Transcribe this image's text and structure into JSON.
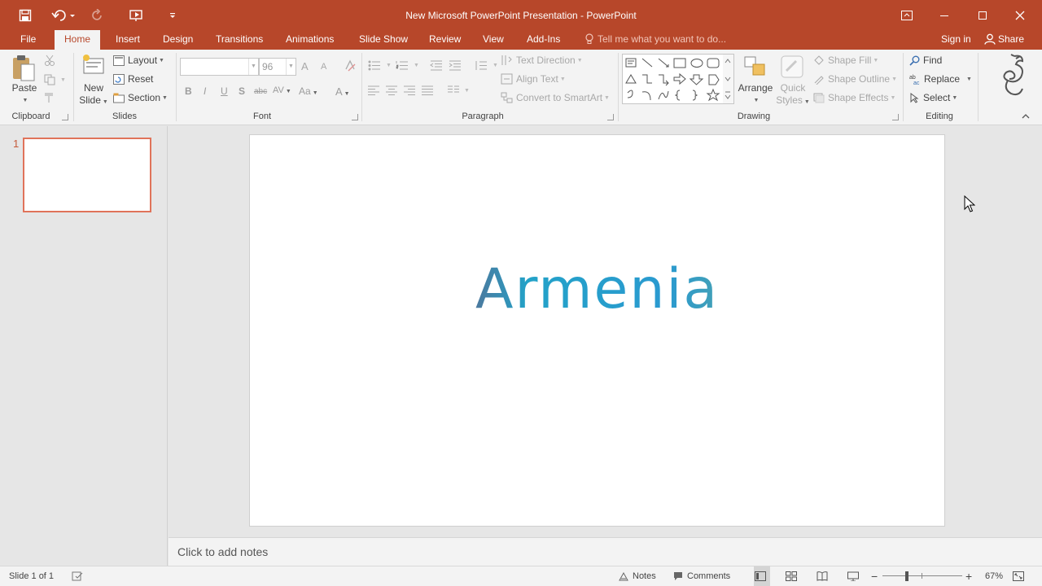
{
  "window": {
    "title": "New Microsoft PowerPoint Presentation - PowerPoint",
    "accent": "#b7472a"
  },
  "quick_access": [
    "save-icon",
    "undo-icon",
    "redo-icon",
    "start-from-beginning-icon",
    "customize-qat-icon"
  ],
  "tabs": [
    {
      "label": "File"
    },
    {
      "label": "Home"
    },
    {
      "label": "Insert"
    },
    {
      "label": "Design"
    },
    {
      "label": "Transitions"
    },
    {
      "label": "Animations"
    },
    {
      "label": "Slide Show"
    },
    {
      "label": "Review"
    },
    {
      "label": "View"
    },
    {
      "label": "Add-Ins"
    }
  ],
  "active_tab": "Home",
  "tell_me": "Tell me what you want to do...",
  "account": {
    "sign_in": "Sign in",
    "share": "Share"
  },
  "ribbon": {
    "clipboard": {
      "group": "Clipboard",
      "paste": "Paste"
    },
    "slides": {
      "group": "Slides",
      "new_slide_1": "New",
      "new_slide_2": "Slide",
      "layout": "Layout",
      "reset": "Reset",
      "section": "Section"
    },
    "font": {
      "group": "Font",
      "font_name": "",
      "font_size": "96",
      "bold": "B",
      "italic": "I",
      "underline": "U",
      "shadow": "S",
      "strike": "abc",
      "spacing": "AV",
      "change_case": "Aa",
      "grow": "A",
      "shrink": "A",
      "color": "A"
    },
    "paragraph": {
      "group": "Paragraph",
      "text_direction": "Text Direction",
      "align_text": "Align Text",
      "convert_smartart": "Convert to SmartArt"
    },
    "drawing": {
      "group": "Drawing",
      "arrange": "Arrange",
      "quick_styles_1": "Quick",
      "quick_styles_2": "Styles",
      "shape_fill": "Shape Fill",
      "shape_outline": "Shape Outline",
      "shape_effects": "Shape Effects"
    },
    "editing": {
      "group": "Editing",
      "find": "Find",
      "replace": "Replace",
      "select": "Select"
    }
  },
  "slides": [
    {
      "number": "1"
    }
  ],
  "slide": {
    "title_text": "Armenia"
  },
  "notes": {
    "placeholder": "Click to add notes"
  },
  "status": {
    "slide_info": "Slide 1 of 1",
    "notes_btn": "Notes",
    "comments_btn": "Comments",
    "zoom": "67%",
    "zoom_fraction": 0.67
  }
}
